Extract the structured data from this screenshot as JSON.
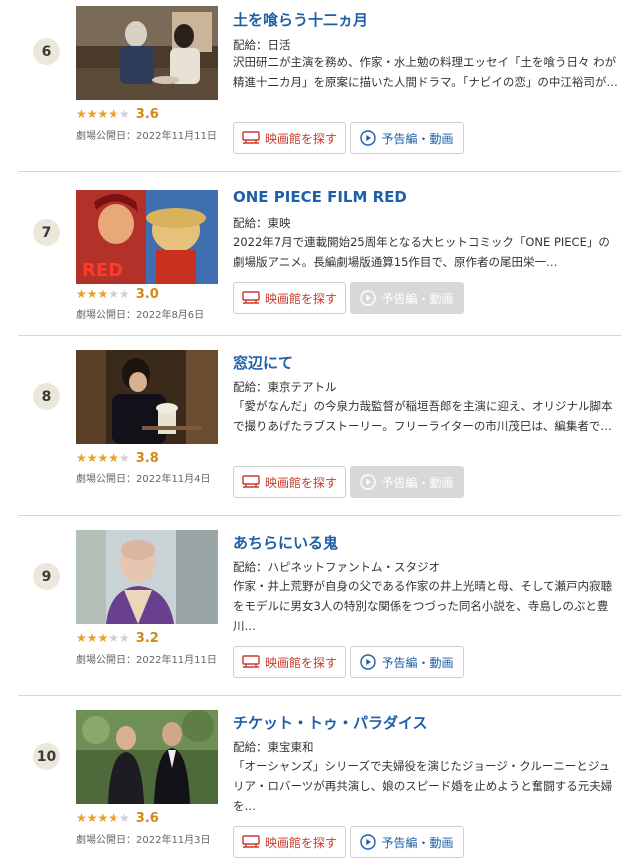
{
  "movies": [
    {
      "rank": "6",
      "title": "土を喰らう十二ヵ月",
      "distributor": "配給：日活",
      "description": "沢田研二が主演を務め、作家・水上勉の料理エッセイ「土を喰う日々 わが精進十二カ月」を原案に描いた人間ドラマ。「ナビイの恋」の中江裕司が…",
      "rating": 3.6,
      "score": "3.6",
      "release": "劇場公開日：2022年11月11日",
      "theater_label": "映画館を探す",
      "trailer_label": "予告編・動画",
      "trailer_available": true
    },
    {
      "rank": "7",
      "title": "ONE PIECE FILM RED",
      "distributor": "配給：東映",
      "description": "2022年7月で連載開始25周年となる大ヒットコミック「ONE PIECE」の劇場版アニメ。長編劇場版通算15作目で、原作者の尾田栄一…",
      "rating": 3.0,
      "score": "3.0",
      "release": "劇場公開日：2022年8月6日",
      "theater_label": "映画館を探す",
      "trailer_label": "予告編・動画",
      "trailer_available": false,
      "poster_text": "RED"
    },
    {
      "rank": "8",
      "title": "窓辺にて",
      "distributor": "配給：東京テアトル",
      "description": "「愛がなんだ」の今泉力哉監督が稲垣吾郎を主演に迎え、オリジナル脚本で撮りあげたラブストーリー。フリーライターの市川茂巳は、編集者で…",
      "rating": 3.8,
      "score": "3.8",
      "release": "劇場公開日：2022年11月4日",
      "theater_label": "映画館を探す",
      "trailer_label": "予告編・動画",
      "trailer_available": false
    },
    {
      "rank": "9",
      "title": "あちらにいる鬼",
      "distributor": "配給：ハピネットファントム・スタジオ",
      "description": "作家・井上荒野が自身の父である作家の井上光晴と母、そして瀬戸内寂聴をモデルに男女3人の特別な関係をつづった同名小説を、寺島しのぶと豊川…",
      "rating": 3.2,
      "score": "3.2",
      "release": "劇場公開日：2022年11月11日",
      "theater_label": "映画館を探す",
      "trailer_label": "予告編・動画",
      "trailer_available": true
    },
    {
      "rank": "10",
      "title": "チケット・トゥ・パラダイス",
      "distributor": "配給：東宝東和",
      "description": "「オーシャンズ」シリーズで夫婦役を演じたジョージ・クルーニーとジュリア・ロバーツが再共演し、娘のスピード婚を止めようと奮闘する元夫婦を…",
      "rating": 3.6,
      "score": "3.6",
      "release": "劇場公開日：2022年11月3日",
      "theater_label": "映画館を探す",
      "trailer_label": "予告編・動画",
      "trailer_available": true
    }
  ],
  "colors": {
    "title": "#1f5fa8",
    "star": "#f0a020",
    "score": "#d08a14",
    "theater_button": "#c83a2a",
    "trailer_button": "#1f5fa8",
    "trailer_disabled_bg": "#d8d8d8",
    "rank_badge": "#ebe7da"
  },
  "icons": {
    "star": "star-icon",
    "theater": "theater-seat-icon",
    "trailer": "play-circle-icon"
  }
}
